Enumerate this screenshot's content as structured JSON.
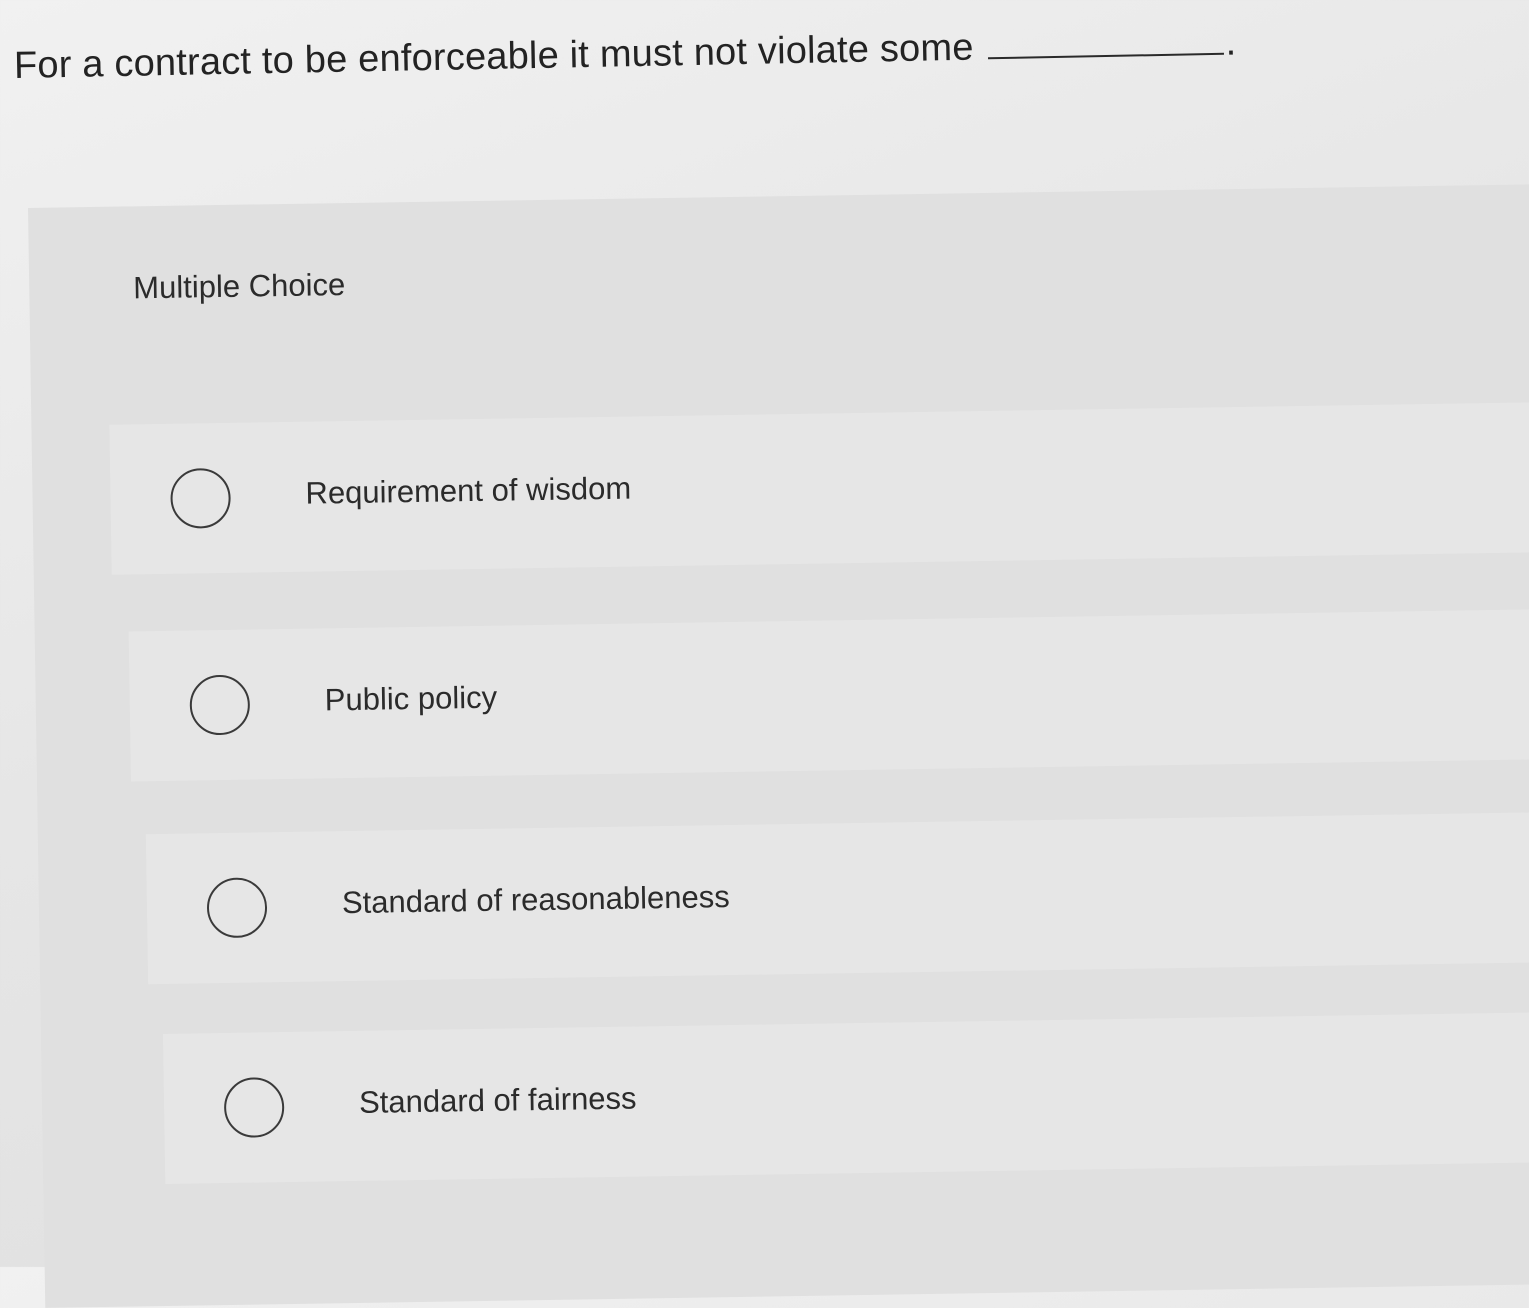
{
  "question": {
    "text": "For a contract to be enforceable it must not violate some",
    "period": "."
  },
  "multiple_choice": {
    "label": "Multiple Choice",
    "options": [
      {
        "label": "Requirement of wisdom",
        "selected": false
      },
      {
        "label": "Public policy",
        "selected": false
      },
      {
        "label": "Standard of reasonableness",
        "selected": false
      },
      {
        "label": "Standard of fairness",
        "selected": false
      }
    ]
  }
}
